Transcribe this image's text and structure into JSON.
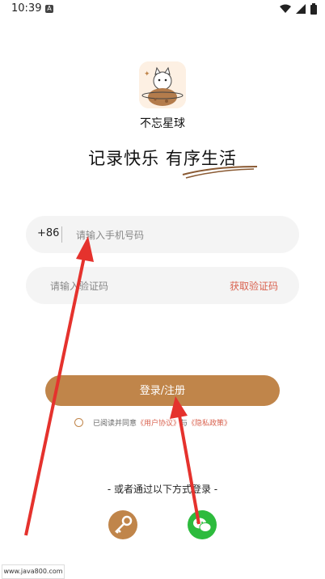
{
  "status_bar": {
    "time": "10:39",
    "notif_letter": "A"
  },
  "app": {
    "name": "不忘星球",
    "slogan": "记录快乐 有序生活"
  },
  "phone": {
    "country_code": "+86",
    "placeholder": "请输入手机号码"
  },
  "code": {
    "placeholder": "请输入验证码",
    "get_code": "获取验证码"
  },
  "login_button": "登录/注册",
  "agreement": {
    "prefix": "已阅读并同意",
    "terms": "《用户协议》",
    "and": "与",
    "privacy": "《隐私政策》"
  },
  "other_login": "- 或者通过以下方式登录 -",
  "icons": {
    "key": "key-icon",
    "wechat": "wechat-icon"
  },
  "watermark": "www.java800.com",
  "colors": {
    "accent": "#c0854a",
    "link": "#d9624f",
    "wechat": "#2dbb3d",
    "arrow": "#e5322d"
  }
}
